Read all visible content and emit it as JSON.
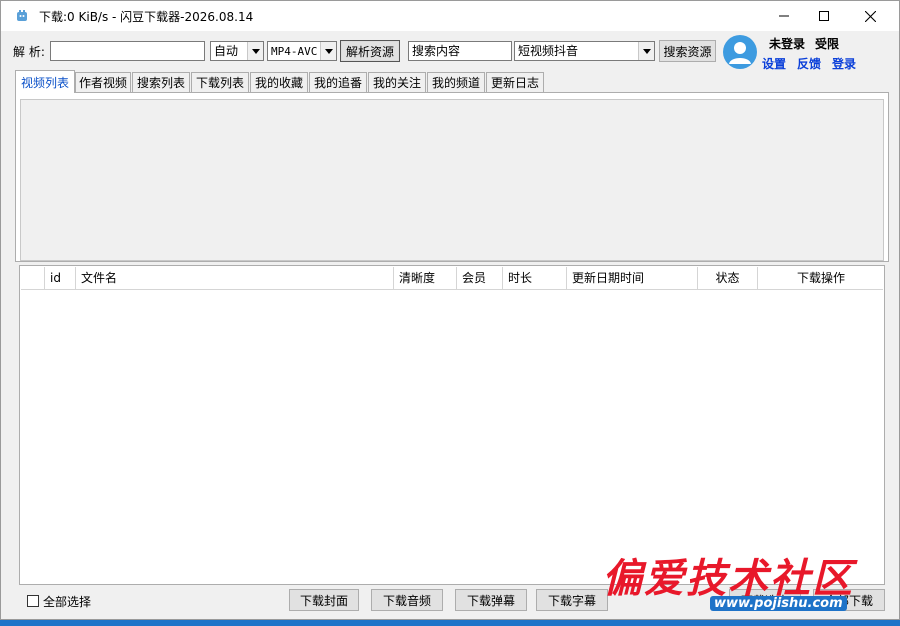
{
  "window": {
    "title": "下载:0 KiB/s - 闪豆下载器-2026.08.14"
  },
  "toolbar": {
    "parse_label": "解 析:",
    "url_input_value": "",
    "quality_select": "自动",
    "format_select": "MP4-AVC",
    "parse_button": "解析资源",
    "search_input_value": "搜索内容",
    "platform_select": "短视频抖音",
    "search_button": "搜索资源"
  },
  "user": {
    "status": "未登录",
    "limit": "受限",
    "links": [
      "设置",
      "反馈",
      "登录"
    ]
  },
  "tabs": [
    "视频列表",
    "作者视频",
    "搜索列表",
    "下载列表",
    "我的收藏",
    "我的追番",
    "我的关注",
    "我的频道",
    "更新日志"
  ],
  "table": {
    "columns": [
      "",
      "id",
      "文件名",
      "清晰度",
      "会员",
      "时长",
      "更新日期时间",
      "状态",
      "下载操作"
    ]
  },
  "bottom": {
    "select_all_label": "全部选择",
    "buttons": [
      "下载封面",
      "下载音频",
      "下载弹幕",
      "下载字幕",
      "下载选中",
      "全部下载"
    ]
  },
  "watermark": {
    "text": "偏爱技术社区",
    "url": "www.pojishu.com"
  },
  "colors": {
    "accent_tab": "#0a50c8",
    "link": "#0a3fd9",
    "avatar": "#3d9be0",
    "watermark": "#e8182a",
    "desktop": "#1e73c8"
  }
}
